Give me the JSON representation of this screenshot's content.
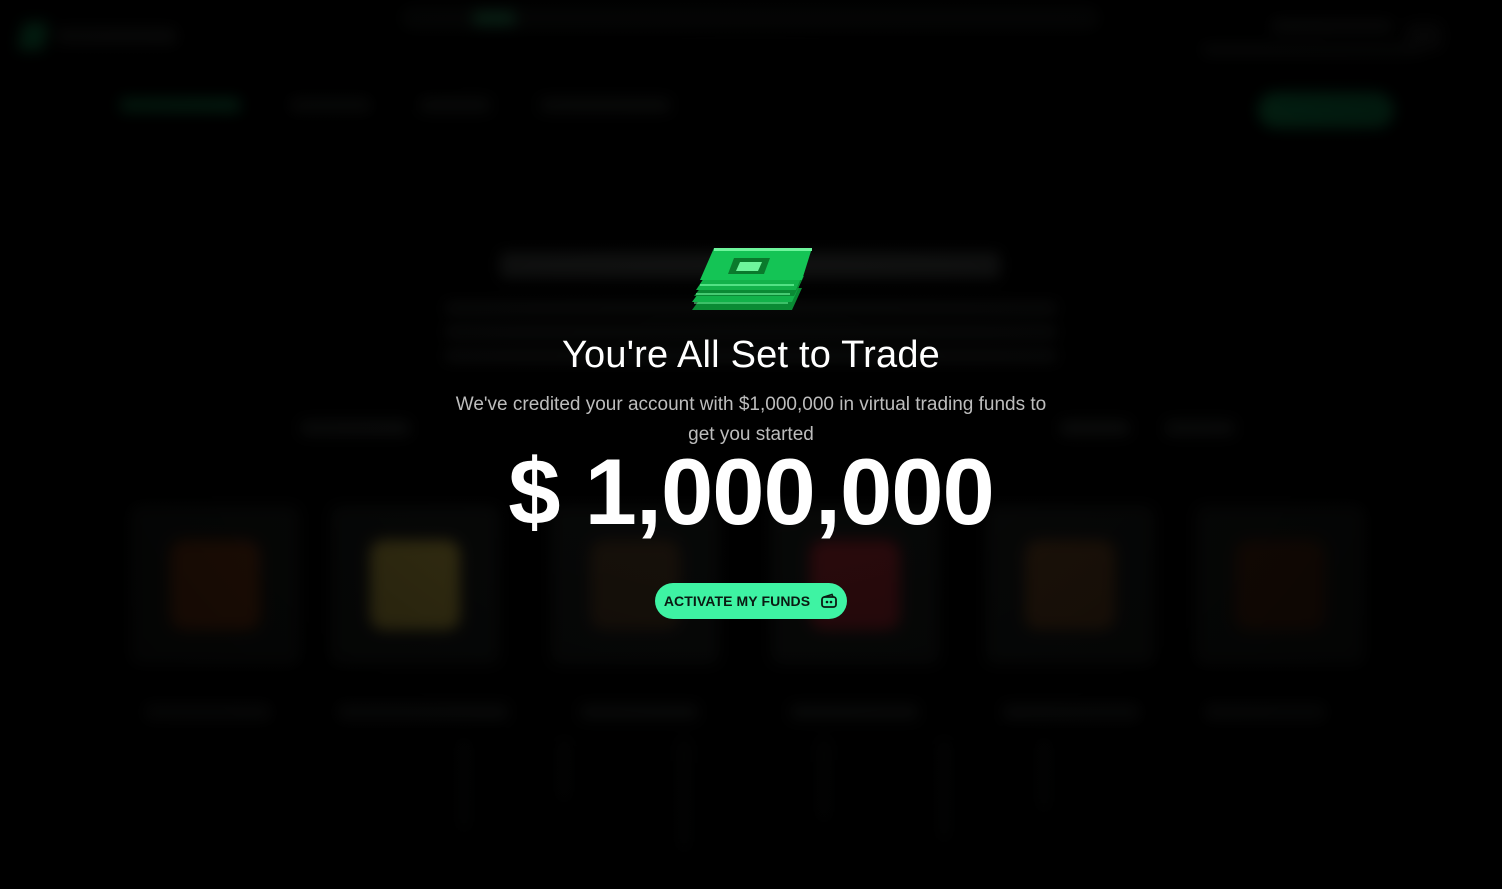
{
  "modal": {
    "icon": "money-stack-icon",
    "title": "You're All Set to Trade",
    "subtitle": "We've credited your account with $1,000,000 in virtual trading funds to get you started",
    "amount": "$ 1,000,000",
    "activate_label": "ACTIVATE MY FUNDS",
    "activate_icon": "wallet-icon"
  },
  "colors": {
    "accent": "#3ef3a3",
    "money_green": "#12b24a",
    "background": "#000000",
    "text_primary": "#ffffff",
    "text_secondary": "#bdbdbd"
  }
}
